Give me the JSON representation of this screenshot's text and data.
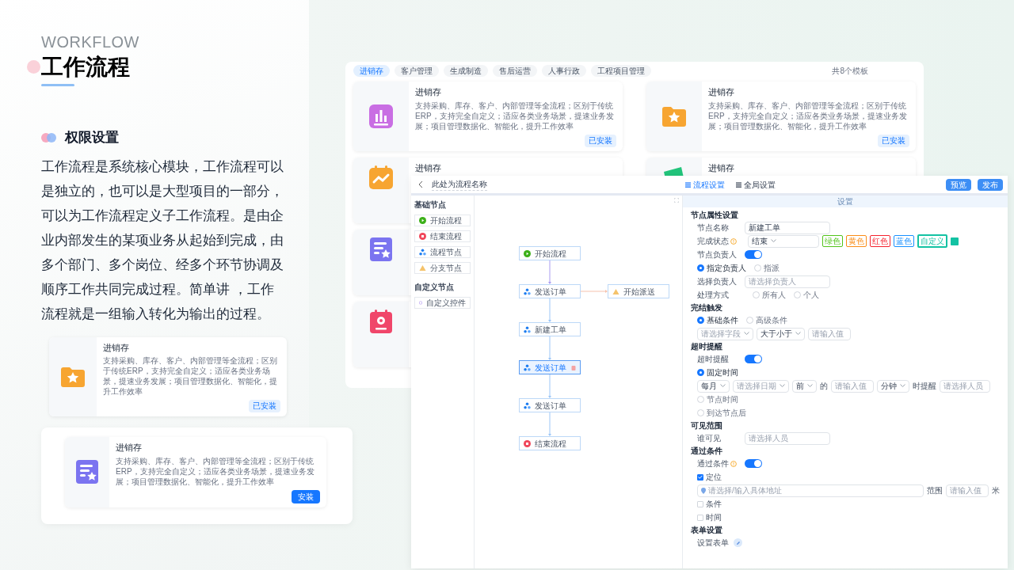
{
  "intro": {
    "eyebrow": "WORKFLOW",
    "title": "工作流程",
    "subtitle": "权限设置",
    "paragraph": "工作流程是系统核心模块，工作流程可以是独立的，也可以是大型项目的一部分，可以为工作流程定义子工作流程。是由企业内部发生的某项业务从起始到完成，由多个部门、多个岗位、经多个环节协调及顺序工作共同完成过程。简单讲 ，工作流程就是一组输入转化为输出的过程。"
  },
  "showcase": [
    {
      "kind": "folder",
      "title": "进销存",
      "description": "支持采购、库存、客户、内部管理等全流程；区别于传统ERP，支持完全自定义；适应各类业务场景，提速业务发展；项目管理数据化、智能化，提升工作效率",
      "button": "已安装",
      "installed": true
    },
    {
      "kind": "doc-star",
      "title": "进销存",
      "description": "支持采购、库存、客户、内部管理等全流程；区别于传统ERP，支持完全自定义；适应各类业务场景，提速业务发展；项目管理数据化、智能化，提升工作效率",
      "button": "安装",
      "installed": false
    }
  ],
  "templates": {
    "tabs": [
      {
        "label": "进销存",
        "selected": true
      },
      {
        "label": "客户管理",
        "selected": false
      },
      {
        "label": "生成制造",
        "selected": false
      },
      {
        "label": "售后运营",
        "selected": false
      },
      {
        "label": "人事行政",
        "selected": false
      },
      {
        "label": "工程项目管理",
        "selected": false
      }
    ],
    "count": "共8个模板",
    "cards": [
      {
        "kind": "chart",
        "title": "进销存",
        "description": "支持采购、库存、客户、内部管理等全流程；区别于传统ERP，支持完全自定义；适应各类业务场景，提速业务发展；项目管理数据化、智能化，提升工作效率",
        "button": "已安装",
        "installed": true
      },
      {
        "kind": "folder",
        "title": "进销存",
        "description": "支持采购、库存、客户、内部管理等全流程；区别于传统ERP，支持完全自定义；适应各类业务场景，提速业务发展；项目管理数据化、智能化，提升工作效率",
        "button": "已安装",
        "installed": true
      },
      {
        "kind": "calendar-wave",
        "title": "进销存"
      },
      {
        "kind": "ticket",
        "title": "进销存"
      },
      {
        "kind": "doc-star"
      },
      {
        "kind": "calendar-badge"
      }
    ]
  },
  "editor": {
    "name": "此处为流程名称",
    "tabs": [
      {
        "label": "流程设置",
        "selected": true
      },
      {
        "label": "全局设置",
        "selected": false
      }
    ],
    "buttons": [
      "预览",
      "发布"
    ],
    "palette": [
      {
        "title": "基础节点",
        "items": [
          {
            "kind": "start",
            "label": "开始流程"
          },
          {
            "kind": "end",
            "label": "结束流程"
          },
          {
            "kind": "process",
            "label": "流程节点"
          },
          {
            "kind": "branch",
            "label": "分支节点"
          }
        ]
      },
      {
        "title": "自定义节点",
        "items": [
          {
            "kind": "custom",
            "label": "自定义控件"
          }
        ]
      }
    ],
    "flow": [
      {
        "kind": "start",
        "label": "开始流程",
        "selected": false
      },
      {
        "kind": "process",
        "label": "发送订单",
        "selected": false,
        "branch": {
          "kind": "branch",
          "label": "开始派送",
          "selected": false
        }
      },
      {
        "kind": "process",
        "label": "新建工单",
        "selected": false
      },
      {
        "kind": "process",
        "label": "发送订单",
        "selected": true
      },
      {
        "kind": "process",
        "label": "发送订单",
        "selected": false
      },
      {
        "kind": "end",
        "label": "结束流程",
        "selected": false
      }
    ],
    "settings": {
      "header": "设置",
      "sections": [
        {
          "title": "节点属性设置",
          "rows": [
            {
              "kind": "field",
              "label": "节点名称",
              "value": "新建工单"
            },
            {
              "kind": "status",
              "label": "完成状态",
              "hint": true,
              "value": "结束",
              "tags": [
                {
                  "label": "绿色",
                  "color": "#52c41a",
                  "selected": false
                },
                {
                  "label": "黄色",
                  "color": "#fa8c16",
                  "selected": false
                },
                {
                  "label": "红色",
                  "color": "#f5222d",
                  "selected": false
                },
                {
                  "label": "蓝色",
                  "color": "#1890ff",
                  "selected": false
                },
                {
                  "label": "自定义",
                  "color": "#13c2a3",
                  "selected": true
                }
              ]
            },
            {
              "kind": "toggle",
              "label": "节点负责人",
              "on": true
            },
            {
              "kind": "radios",
              "options": [
                {
                  "label": "指定负责人",
                  "selected": true
                },
                {
                  "label": "指派",
                  "selected": false
                }
              ]
            },
            {
              "kind": "field",
              "label": "选择负责人",
              "placeholder": "请选择负责人"
            },
            {
              "kind": "radios",
              "label": "处理方式",
              "options": [
                {
                  "label": "所有人",
                  "selected": false
                },
                {
                  "label": "个人",
                  "selected": false
                }
              ]
            }
          ]
        },
        {
          "title": "完结触发",
          "rows": [
            {
              "kind": "radios",
              "options": [
                {
                  "label": "基础条件",
                  "selected": true
                },
                {
                  "label": "高级条件",
                  "selected": false
                }
              ]
            },
            {
              "kind": "controls",
              "items": [
                {
                  "kind": "select",
                  "placeholder": "请选择字段"
                },
                {
                  "kind": "select",
                  "value": "大于小于"
                },
                {
                  "kind": "input",
                  "placeholder": "请输入值"
                }
              ]
            }
          ]
        },
        {
          "title": "超时提醒",
          "rows": [
            {
              "kind": "toggle",
              "label": "超时提醒",
              "on": true
            },
            {
              "kind": "radios",
              "options": [
                {
                  "label": "固定时间",
                  "selected": true
                }
              ]
            },
            {
              "kind": "controls",
              "items": [
                {
                  "kind": "select",
                  "value": "每月"
                },
                {
                  "kind": "select",
                  "placeholder": "请选择日期"
                },
                {
                  "kind": "select",
                  "value": "前"
                },
                {
                  "kind": "text",
                  "text": "的"
                },
                {
                  "kind": "input",
                  "placeholder": "请输入值"
                },
                {
                  "kind": "select",
                  "value": "分钟"
                },
                {
                  "kind": "text",
                  "text": "时提醒"
                },
                {
                  "kind": "input",
                  "placeholder": "请选择人员"
                }
              ]
            },
            {
              "kind": "radios",
              "options": [
                {
                  "label": "节点时间",
                  "selected": false
                }
              ]
            },
            {
              "kind": "radios",
              "options": [
                {
                  "label": "到达节点后",
                  "selected": false
                }
              ]
            }
          ]
        },
        {
          "title": "可见范围",
          "rows": [
            {
              "kind": "field",
              "label": "谁可见",
              "placeholder": "请选择人员"
            }
          ]
        },
        {
          "title": "通过条件",
          "rows": [
            {
              "kind": "toggle",
              "label": "通过条件",
              "hint": true,
              "on": true
            },
            {
              "kind": "checkbox",
              "label": "定位",
              "checked": true
            },
            {
              "kind": "controls",
              "items": [
                {
                  "kind": "location",
                  "placeholder": "请选择/输入具体地址"
                },
                {
                  "kind": "text",
                  "text": "范围"
                },
                {
                  "kind": "input",
                  "placeholder": "请输入值"
                },
                {
                  "kind": "text",
                  "text": "米"
                }
              ]
            },
            {
              "kind": "checkbox",
              "label": "条件",
              "checked": false
            },
            {
              "kind": "checkbox",
              "label": "时间",
              "checked": false
            }
          ]
        },
        {
          "title": "表单设置",
          "rows": [
            {
              "kind": "action",
              "label": "设置表单"
            }
          ]
        }
      ]
    }
  }
}
